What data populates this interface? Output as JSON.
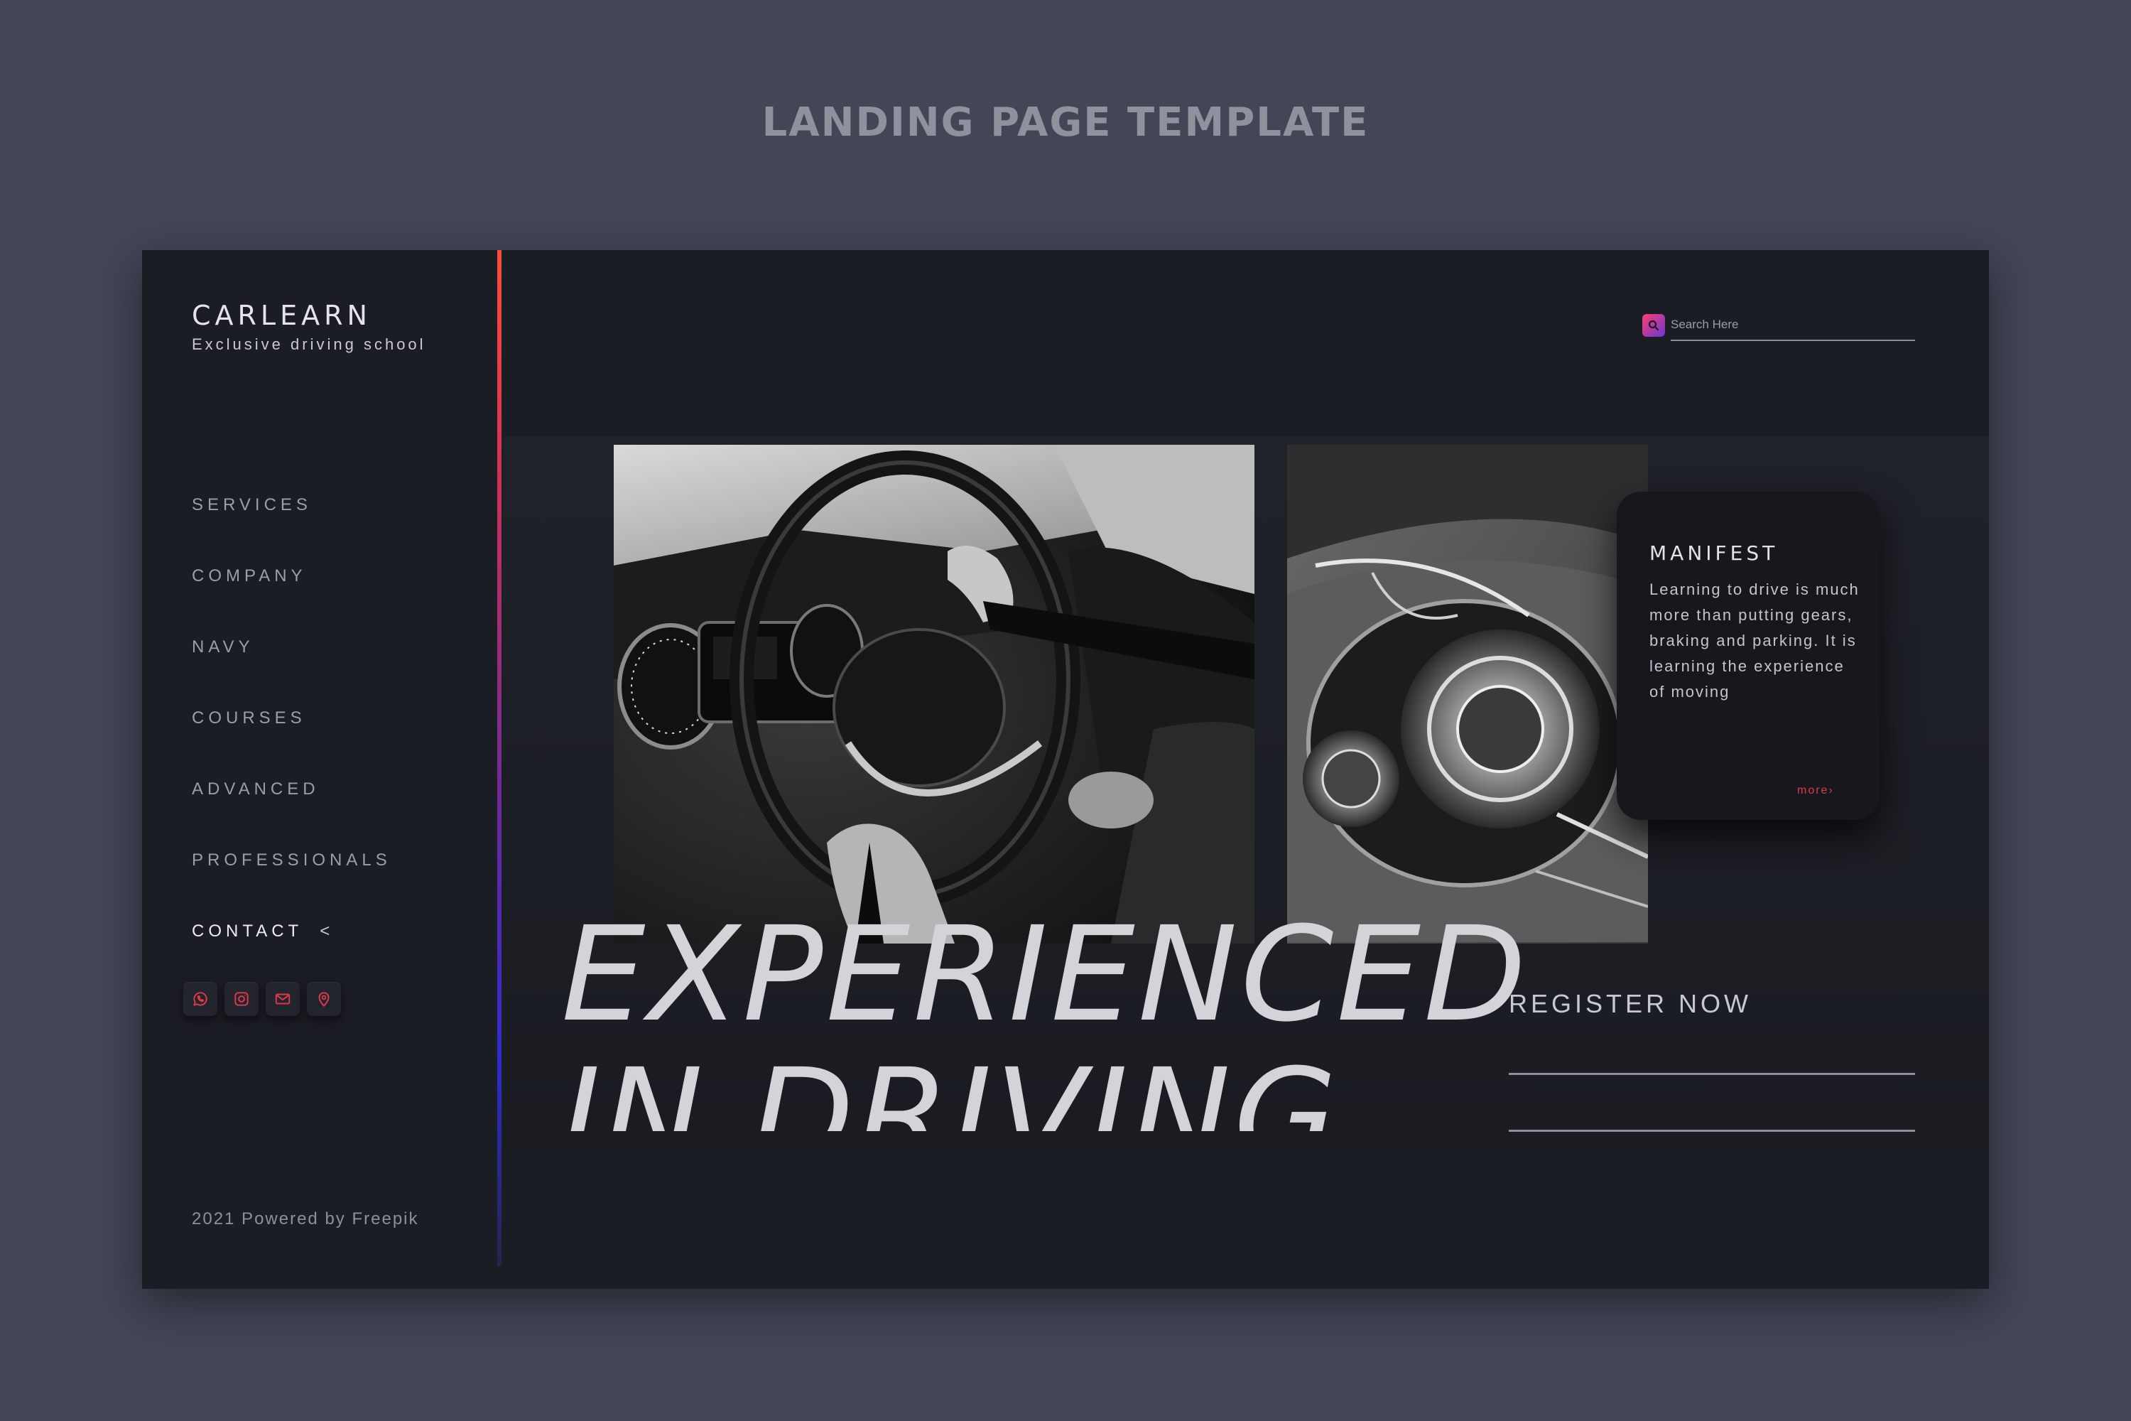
{
  "page": {
    "title": "LANDING PAGE TEMPLATE"
  },
  "brand": {
    "name": "CARLEARN",
    "tagline": "Exclusive driving school"
  },
  "nav": {
    "items": [
      {
        "label": "SERVICES"
      },
      {
        "label": "COMPANY"
      },
      {
        "label": "NAVY"
      },
      {
        "label": "COURSES"
      },
      {
        "label": "ADVANCED"
      },
      {
        "label": "PROFESSIONALS"
      },
      {
        "label": "CONTACT",
        "active": true,
        "chevron": "<"
      }
    ]
  },
  "socials": [
    {
      "icon": "whatsapp-icon"
    },
    {
      "icon": "instagram-icon"
    },
    {
      "icon": "mail-icon"
    },
    {
      "icon": "location-pin-icon"
    }
  ],
  "search": {
    "placeholder": "Search Here",
    "icon": "search-icon"
  },
  "hero": {
    "headline_line1": "EXPERIENCED",
    "headline_line2": "IN DRIVING"
  },
  "card": {
    "title": "MANIFEST",
    "text": "Learning to drive is much more than putting gears, braking and parking. It is learning the experience of moving",
    "more": "more›"
  },
  "register": {
    "label": "REGISTER NOW"
  },
  "footer": {
    "note": "2021 Powered by Freepik"
  },
  "colors": {
    "background": "#434656",
    "panel": "#1b1d24",
    "accent_red": "#ff4b3a",
    "accent_blue": "#2f2ad0",
    "icon_accent": "#e0384b"
  }
}
